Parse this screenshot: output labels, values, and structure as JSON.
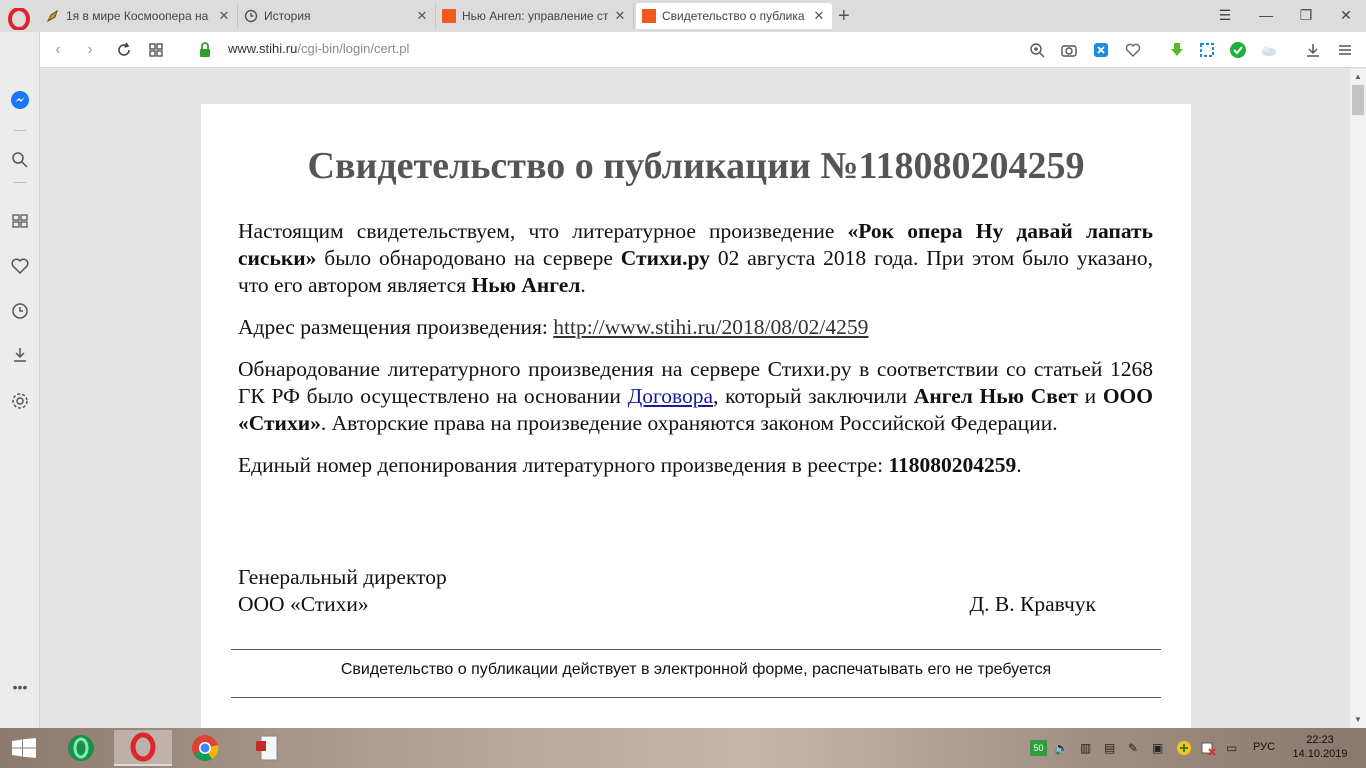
{
  "browser": {
    "tabs": [
      {
        "title": "1я в мире Космоопера на"
      },
      {
        "title": "История"
      },
      {
        "title": "Нью Ангел: управление ст"
      },
      {
        "title": "Свидетельство о публика"
      }
    ],
    "url": {
      "host": "www.stihi.ru",
      "path": "/cgi-bin/login/cert.pl"
    }
  },
  "document": {
    "title": "Свидетельство о публикации №118080204259",
    "p1": {
      "before": "Настоящим свидетельствуем, что литературное произведение ",
      "work": "«Рок опера Ну давай лапать сиськи»",
      "mid1": " было обнародовано на сервере ",
      "site": "Стихи.ру",
      "mid2": " 02 августа 2018 года. При этом было указано, что его автором является ",
      "author": "Нью Ангел",
      "end": "."
    },
    "p2": {
      "label": "Адрес размещения произведения: ",
      "link": "http://www.stihi.ru/2018/08/02/4259"
    },
    "p3": {
      "before": "Обнародование литературного произведения на сервере Стихи.ру в соответствии со статьей 1268 ГК РФ было осуществлено на основании ",
      "contract": "Договора",
      "mid1": ", который заключили ",
      "party1": "Ангел Нью Свет",
      "and": " и ",
      "party2": "ООО «Стихи»",
      "end": ". Авторские права на произведение охраняются законом Российской Федерации."
    },
    "p4": {
      "label": "Единый номер депонирования литературного произведения в реестре: ",
      "number": "118080204259",
      "end": "."
    },
    "signature": {
      "role": "Генеральный директор",
      "org": "ООО «Стихи»",
      "name": "Д. В. Кравчук"
    },
    "notice": "Свидетельство о публикации действует в электронной форме, распечатывать его не требуется"
  },
  "taskbar": {
    "battery": "50",
    "language": "РУС",
    "time": "22:23",
    "date": "14.10.2019"
  },
  "colors": {
    "opera_red": "#e0242d",
    "stihi_orange": "#f05a1a",
    "security_green": "#2e9e2e",
    "title_gray": "#555555"
  },
  "icons": {
    "sidebar": [
      "messenger-icon",
      "search-icon",
      "speed-dial-icon",
      "heart-icon",
      "history-icon",
      "downloads-icon",
      "settings-icon",
      "more-icon"
    ],
    "toolbar": [
      "zoom-icon",
      "camera-icon",
      "shield-icon",
      "heart-icon",
      "download-ext-icon",
      "crop-icon",
      "check-icon",
      "weather-icon",
      "downloads-icon",
      "menu-icon"
    ]
  }
}
